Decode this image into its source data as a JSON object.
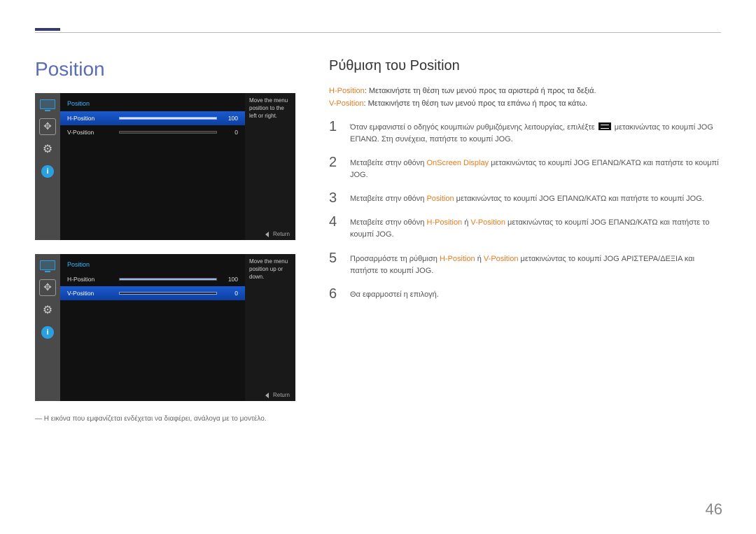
{
  "page_number": "46",
  "left": {
    "title": "Position",
    "footnote": "― Η εικόνα που εμφανίζεται ενδέχεται να διαφέρει, ανάλογα με το μοντέλο."
  },
  "osd1": {
    "title": "Position",
    "rows": [
      {
        "label": "H-Position",
        "value": "100",
        "fill_pct": 100,
        "selected": true
      },
      {
        "label": "V-Position",
        "value": "0",
        "fill_pct": 0,
        "selected": false
      }
    ],
    "sidetext": "Move the menu position to the left or right.",
    "return": "Return"
  },
  "osd2": {
    "title": "Position",
    "rows": [
      {
        "label": "H-Position",
        "value": "100",
        "fill_pct": 100,
        "selected": false
      },
      {
        "label": "V-Position",
        "value": "0",
        "fill_pct": 0,
        "selected": true
      }
    ],
    "sidetext": "Move the menu position up or down.",
    "return": "Return"
  },
  "right": {
    "title": "Ρύθμιση του Position",
    "def_h_label": "H-Position",
    "def_h_text": ": Μετακινήστε τη θέση των μενού προς τα αριστερά ή προς τα δεξιά.",
    "def_v_label": "V-Position",
    "def_v_text": ": Μετακινήστε τη θέση των μενού προς τα επάνω ή προς τα κάτω.",
    "steps": [
      {
        "num": "1",
        "pre": "Όταν εμφανιστεί ο οδηγός κουμπιών ρυθμιζόμενης λειτουργίας, επιλέξτε ",
        "post": " μετακινώντας το κουμπί JOG ΕΠΑΝΩ. Στη συνέχεια, πατήστε το κουμπί JOG.",
        "has_icon": true
      },
      {
        "num": "2",
        "pre": "Μεταβείτε στην οθόνη ",
        "hl1": "OnScreen Display",
        "post": " μετακινώντας το κουμπί JOG ΕΠΑΝΩ/ΚΑΤΩ και πατήστε το κουμπί JOG."
      },
      {
        "num": "3",
        "pre": "Μεταβείτε στην οθόνη ",
        "hl1": "Position",
        "post": " μετακινώντας το κουμπί JOG ΕΠΑΝΩ/ΚΑΤΩ και πατήστε το κουμπί JOG."
      },
      {
        "num": "4",
        "pre": "Μεταβείτε στην οθόνη ",
        "hl1": "H-Position",
        "sep": " ή ",
        "hl2": "V-Position",
        "post": " μετακινώντας το κουμπί JOG ΕΠΑΝΩ/ΚΑΤΩ και πατήστε το κουμπί JOG."
      },
      {
        "num": "5",
        "pre": "Προσαρμόστε τη ρύθμιση ",
        "hl1": "H-Position",
        "sep": " ή ",
        "hl2": "V-Position",
        "post": " μετακινώντας το κουμπί JOG ΑΡΙΣΤΕΡΑ/ΔΕΞΙΑ και πατήστε το κουμπί JOG."
      },
      {
        "num": "6",
        "pre": "Θα εφαρμοστεί η επιλογή."
      }
    ]
  }
}
